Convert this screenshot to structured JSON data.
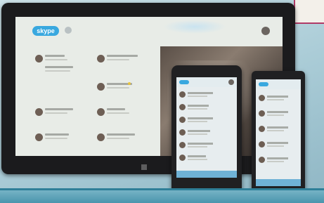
{
  "tablet": {
    "logo_text": "skype",
    "status_text": "",
    "user_text": "",
    "sections": [
      "",
      "",
      ""
    ]
  },
  "colors": {
    "skype_blue": "#39a8df",
    "presence_yellow": "#e7c33b",
    "magazine_magenta": "#b03a66"
  },
  "icons": {
    "logo": "skype-logo",
    "windows": "windows-logo-icon"
  }
}
